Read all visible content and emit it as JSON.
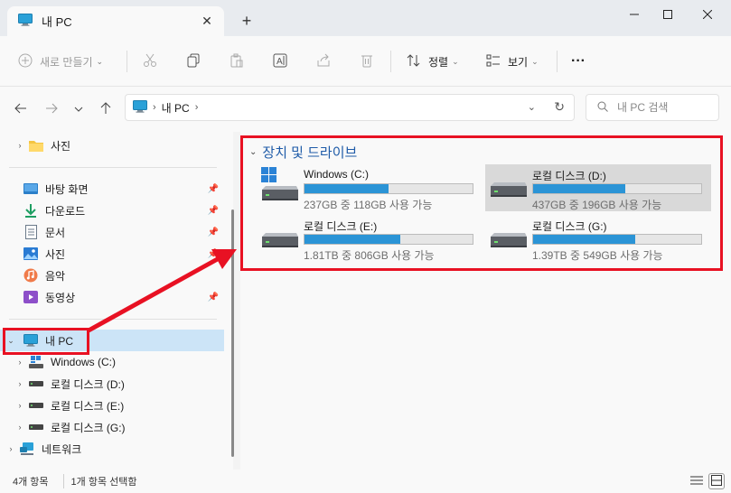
{
  "tab": {
    "title": "내 PC",
    "close": "✕",
    "add": "+"
  },
  "window_controls": {
    "minimize": "—",
    "maximize": "☐",
    "close": "✕"
  },
  "toolbar": {
    "new_label": "새로 만들기",
    "sort_label": "정렬",
    "view_label": "보기",
    "more_label": "···"
  },
  "address": {
    "crumb": "내 PC"
  },
  "search": {
    "placeholder": "내 PC 검색"
  },
  "sidebar": {
    "items": [
      {
        "label": "사진"
      },
      {
        "label": "바탕 화면"
      },
      {
        "label": "다운로드"
      },
      {
        "label": "문서"
      },
      {
        "label": "사진"
      },
      {
        "label": "음악"
      },
      {
        "label": "동영상"
      },
      {
        "label": "내 PC"
      },
      {
        "label": "Windows (C:)"
      },
      {
        "label": "로컬 디스크 (D:)"
      },
      {
        "label": "로컬 디스크 (E:)"
      },
      {
        "label": "로컬 디스크 (G:)"
      },
      {
        "label": "네트워크"
      }
    ]
  },
  "main": {
    "group_title": "장치 및 드라이브",
    "drives": [
      {
        "name": "Windows (C:)",
        "free_text": "237GB 중 118GB 사용 가능",
        "used_fraction": 0.5
      },
      {
        "name": "로컬 디스크 (D:)",
        "free_text": "437GB 중 196GB 사용 가능",
        "used_fraction": 0.55
      },
      {
        "name": "로컬 디스크 (E:)",
        "free_text": "1.81TB 중 806GB 사용 가능",
        "used_fraction": 0.57
      },
      {
        "name": "로컬 디스크 (G:)",
        "free_text": "1.39TB 중 549GB 사용 가능",
        "used_fraction": 0.61
      }
    ]
  },
  "status": {
    "count": "4개 항목",
    "selection": "1개 항목 선택함"
  },
  "colors": {
    "accent": "#2b94d6",
    "selection": "#cce4f7",
    "annotation": "#e81123",
    "group_title": "#1e5ba8"
  }
}
